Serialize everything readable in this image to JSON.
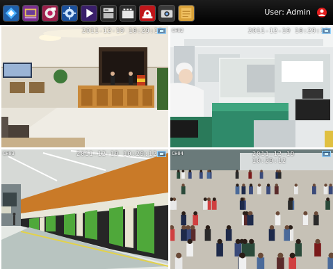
{
  "toolbar": {
    "icons": [
      {
        "name": "live-view-icon"
      },
      {
        "name": "playback-icon"
      },
      {
        "name": "record-icon"
      },
      {
        "name": "settings-icon"
      },
      {
        "name": "media-player-icon"
      },
      {
        "name": "storage-icon"
      },
      {
        "name": "video-clip-icon"
      },
      {
        "name": "alarm-icon"
      },
      {
        "name": "camera-icon"
      },
      {
        "name": "notes-icon"
      }
    ]
  },
  "user": {
    "label": "User:",
    "name": "Admin",
    "badge_icon": "user-badge-icon"
  },
  "cameras": [
    {
      "channel": "",
      "timestamp": "2011-12-19 10:29:12",
      "scene": "hotel-lobby"
    },
    {
      "channel": "CH02",
      "timestamp": "2011-12-19 10:29:12",
      "scene": "laboratory"
    },
    {
      "channel": "CH03",
      "timestamp": "2011-12-19 10:29:12",
      "scene": "subway-platform"
    },
    {
      "channel": "CH04",
      "timestamp": "2011-12-19 10:29:12",
      "scene": "street-crowd"
    }
  ],
  "colors": {
    "toolbar_bg": "#000000",
    "osd_text": "#ffffff",
    "rec_indicator": "#9ad7ff"
  }
}
